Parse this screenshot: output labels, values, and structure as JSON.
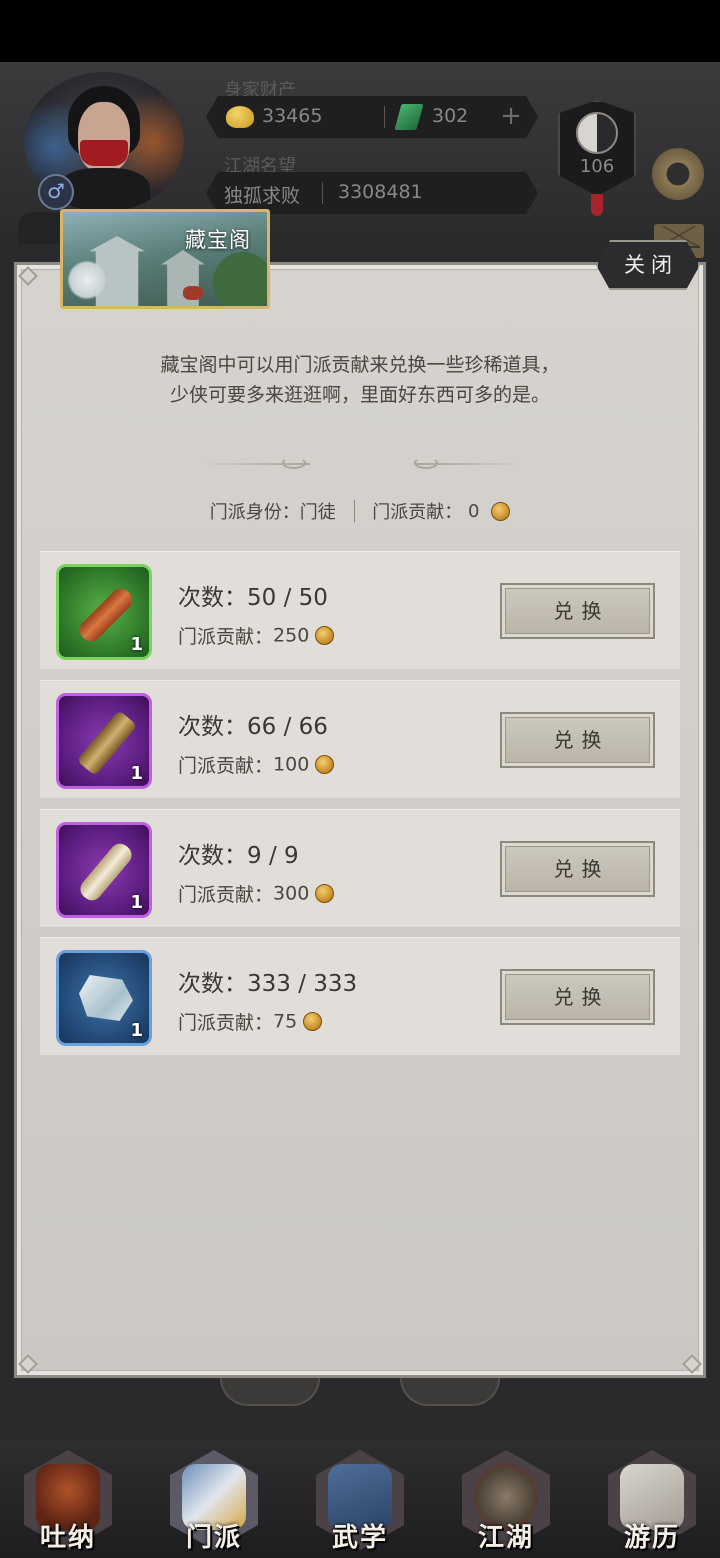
{
  "header": {
    "wealth_label": "身家财产",
    "gold": "33465",
    "gems": "302",
    "plus_label": "+",
    "fame_label": "江湖名望",
    "title_name": "独孤求败",
    "fame_value": "3308481",
    "level": "106",
    "gender_symbol": "♂"
  },
  "dialog": {
    "title": "藏宝阁",
    "close_label": "关闭",
    "description_line1": "藏宝阁中可以用门派贡献来兑换一些珍稀道具，",
    "description_line2": "少侠可要多来逛逛啊，里面好东西可多的是。",
    "identity_label": "门派身份：门徒",
    "contribution_label": "门派贡献：",
    "contribution_value": "0"
  },
  "items": [
    {
      "count_text": "次数：50 / 50",
      "cost_label": "门派贡献：",
      "cost": "250",
      "qty": "1",
      "exchange_label": "兑换",
      "icon_name": "red-scroll-icon",
      "rarity_color": "#4fa83e"
    },
    {
      "count_text": "次数：66 / 66",
      "cost_label": "门派贡献：",
      "cost": "100",
      "qty": "1",
      "exchange_label": "兑换",
      "icon_name": "wood-plank-icon",
      "rarity_color": "#8a3bb0"
    },
    {
      "count_text": "次数：9 / 9",
      "cost_label": "门派贡献：",
      "cost": "300",
      "qty": "1",
      "exchange_label": "兑换",
      "icon_name": "paper-scroll-icon",
      "rarity_color": "#8a3bb0"
    },
    {
      "count_text": "次数：333 / 333",
      "cost_label": "门派贡献：",
      "cost": "75",
      "qty": "1",
      "exchange_label": "兑换",
      "icon_name": "crystal-ore-icon",
      "rarity_color": "#3f73a8"
    }
  ],
  "nav": [
    {
      "label": "吐纳",
      "icon_name": "meditation-icon"
    },
    {
      "label": "门派",
      "icon_name": "sect-icon"
    },
    {
      "label": "武学",
      "icon_name": "martial-book-icon"
    },
    {
      "label": "江湖",
      "icon_name": "straw-hat-icon"
    },
    {
      "label": "游历",
      "icon_name": "horse-icon"
    }
  ]
}
